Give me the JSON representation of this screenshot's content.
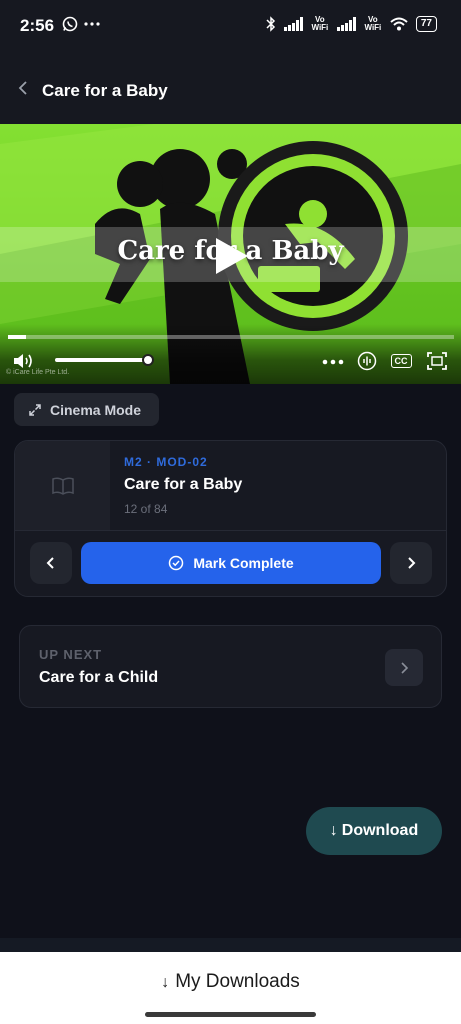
{
  "status_bar": {
    "time": "2:56",
    "left_icons": [
      "whatsapp-icon",
      "more-dots-icon"
    ],
    "vowifi_1": "Vo WiFi",
    "vowifi_2": "Vo WiFi",
    "battery": "77"
  },
  "header": {
    "title": "Care for a Baby",
    "back_icon": "chevron-left-icon"
  },
  "video": {
    "title_overlay": "Care for a Baby",
    "copyright": "© iCare Life Pte Ltd.",
    "progress": 0.04,
    "volume": 1.0,
    "cc_label": "CC",
    "background_color": "#7ad72c"
  },
  "cinema_mode": {
    "label": "Cinema Mode"
  },
  "lesson": {
    "code": "M2 · MOD-02",
    "title": "Care for a Baby",
    "count": "12 of 84",
    "mark_complete_label": "Mark Complete",
    "accent_color": "#2563eb"
  },
  "up_next": {
    "label": "UP NEXT",
    "title": "Care for a Child"
  },
  "download_button": {
    "label": "Download",
    "icon": "↓"
  },
  "bottom": {
    "label": "My Downloads",
    "icon": "↓"
  }
}
